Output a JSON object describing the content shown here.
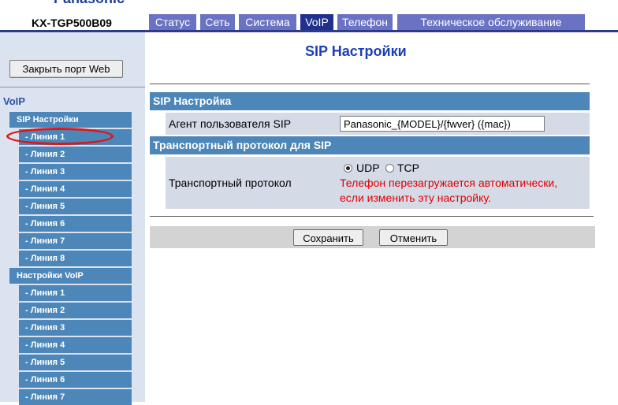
{
  "header": {
    "brand": "Panasonic",
    "model": "KX-TGP500B09",
    "tabs": [
      {
        "label": "Статус",
        "active": false
      },
      {
        "label": "Сеть",
        "active": false
      },
      {
        "label": "Система",
        "active": false
      },
      {
        "label": "VoIP",
        "active": true
      },
      {
        "label": "Телефон",
        "active": false
      },
      {
        "label": "Техническое обслуживание",
        "active": false
      }
    ]
  },
  "sidebar": {
    "close_button": "Закрыть порт Web",
    "section": "VoIP",
    "group1": {
      "label": "SIP Настройки",
      "items": [
        "- Линия 1",
        "- Линия 2",
        "- Линия 3",
        "- Линия 4",
        "- Линия 5",
        "- Линия 6",
        "- Линия 7",
        "- Линия 8"
      ]
    },
    "group2": {
      "label": "Настройки VoIP",
      "items": [
        "- Линия 1",
        "- Линия 2",
        "- Линия 3",
        "- Линия 4",
        "- Линия 5",
        "- Линия 6",
        "- Линия 7"
      ]
    },
    "highlighted_item": "- Линия 1"
  },
  "main": {
    "title": "SIP Настройки",
    "section1": {
      "title": "SIP Настройка",
      "user_agent_label": "Агент пользователя SIP",
      "user_agent_value": "Panasonic_{MODEL}/{fwver} ({mac})"
    },
    "section2": {
      "title": "Транспортный протокол для SIP",
      "transport_label": "Транспортный протокол",
      "options": [
        "UDP",
        "TCP"
      ],
      "selected": "UDP",
      "warning_line1": "Телефон перезагружается автоматически,",
      "warning_line2": "если изменить эту настройку."
    },
    "save_button": "Сохранить",
    "cancel_button": "Отменить"
  },
  "colors": {
    "tab": "#6a72c3",
    "tab_active": "#22308d",
    "sidebar_item": "#4d86b8",
    "section_bar": "#4d86b8",
    "title": "#1c3fb8",
    "warning": "#e00000",
    "highlight_ellipse": "#e01515"
  }
}
